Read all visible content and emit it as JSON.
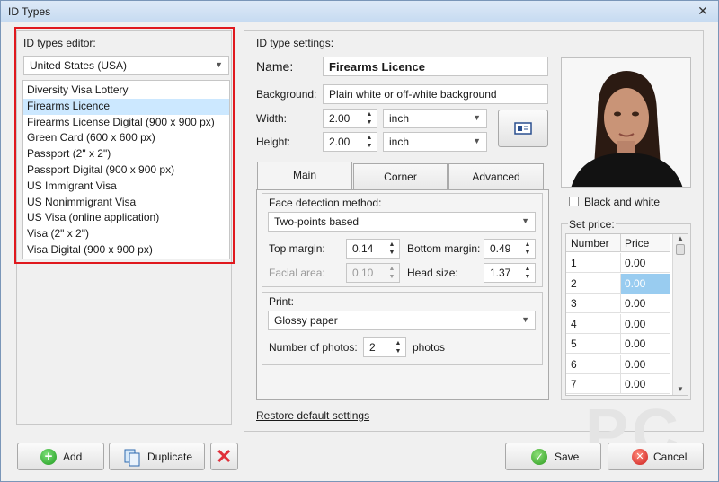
{
  "window": {
    "title": "ID Types",
    "close": "✕"
  },
  "left": {
    "title": "ID types editor:",
    "country": "United States (USA)",
    "items": [
      "Diversity Visa Lottery",
      "Firearms Licence",
      "Firearms License Digital (900 x 900 px)",
      "Green Card (600 x 600 px)",
      "Passport (2\" x 2\")",
      "Passport Digital (900 x 900 px)",
      "US Immigrant Visa",
      "US Nonimmigrant Visa",
      "US Visa (online application)",
      "Visa  (2\" x 2\")",
      "Visa Digital (900 x 900 px)"
    ],
    "selected_index": 1
  },
  "settings": {
    "title": "ID type settings:",
    "name_label": "Name:",
    "name_value": "Firearms Licence",
    "background_label": "Background:",
    "background_value": "Plain white or off-white background",
    "width_label": "Width:",
    "width_value": "2.00",
    "width_unit": "inch",
    "height_label": "Height:",
    "height_value": "2.00",
    "height_unit": "inch"
  },
  "tabs": [
    "Main",
    "Corner",
    "Advanced"
  ],
  "face": {
    "title": "Face detection method:",
    "method": "Two-points based",
    "top_margin_label": "Top margin:",
    "top_margin_value": "0.14",
    "bottom_margin_label": "Bottom margin:",
    "bottom_margin_value": "0.49",
    "facial_area_label": "Facial area:",
    "facial_area_value": "0.10",
    "head_size_label": "Head size:",
    "head_size_value": "1.37"
  },
  "print": {
    "title": "Print:",
    "paper": "Glossy paper",
    "photos_label": "Number of photos:",
    "photos_value": "2",
    "photos_unit": "photos"
  },
  "restore": "Restore default settings",
  "bw_label": "Black and white",
  "price": {
    "title": "Set price:",
    "col_number": "Number",
    "col_price": "Price",
    "rows": [
      {
        "n": "1",
        "p": "0.00"
      },
      {
        "n": "2",
        "p": "0.00"
      },
      {
        "n": "3",
        "p": "0.00"
      },
      {
        "n": "4",
        "p": "0.00"
      },
      {
        "n": "5",
        "p": "0.00"
      },
      {
        "n": "6",
        "p": "0.00"
      },
      {
        "n": "7",
        "p": "0.00"
      }
    ]
  },
  "buttons": {
    "add": "Add",
    "duplicate": "Duplicate",
    "save": "Save",
    "cancel": "Cancel"
  },
  "watermark": "PC",
  "colors": {
    "highlight_red": "#e0191e",
    "selected_row": "#cce8ff",
    "grid_selected": "#99ccf0"
  }
}
